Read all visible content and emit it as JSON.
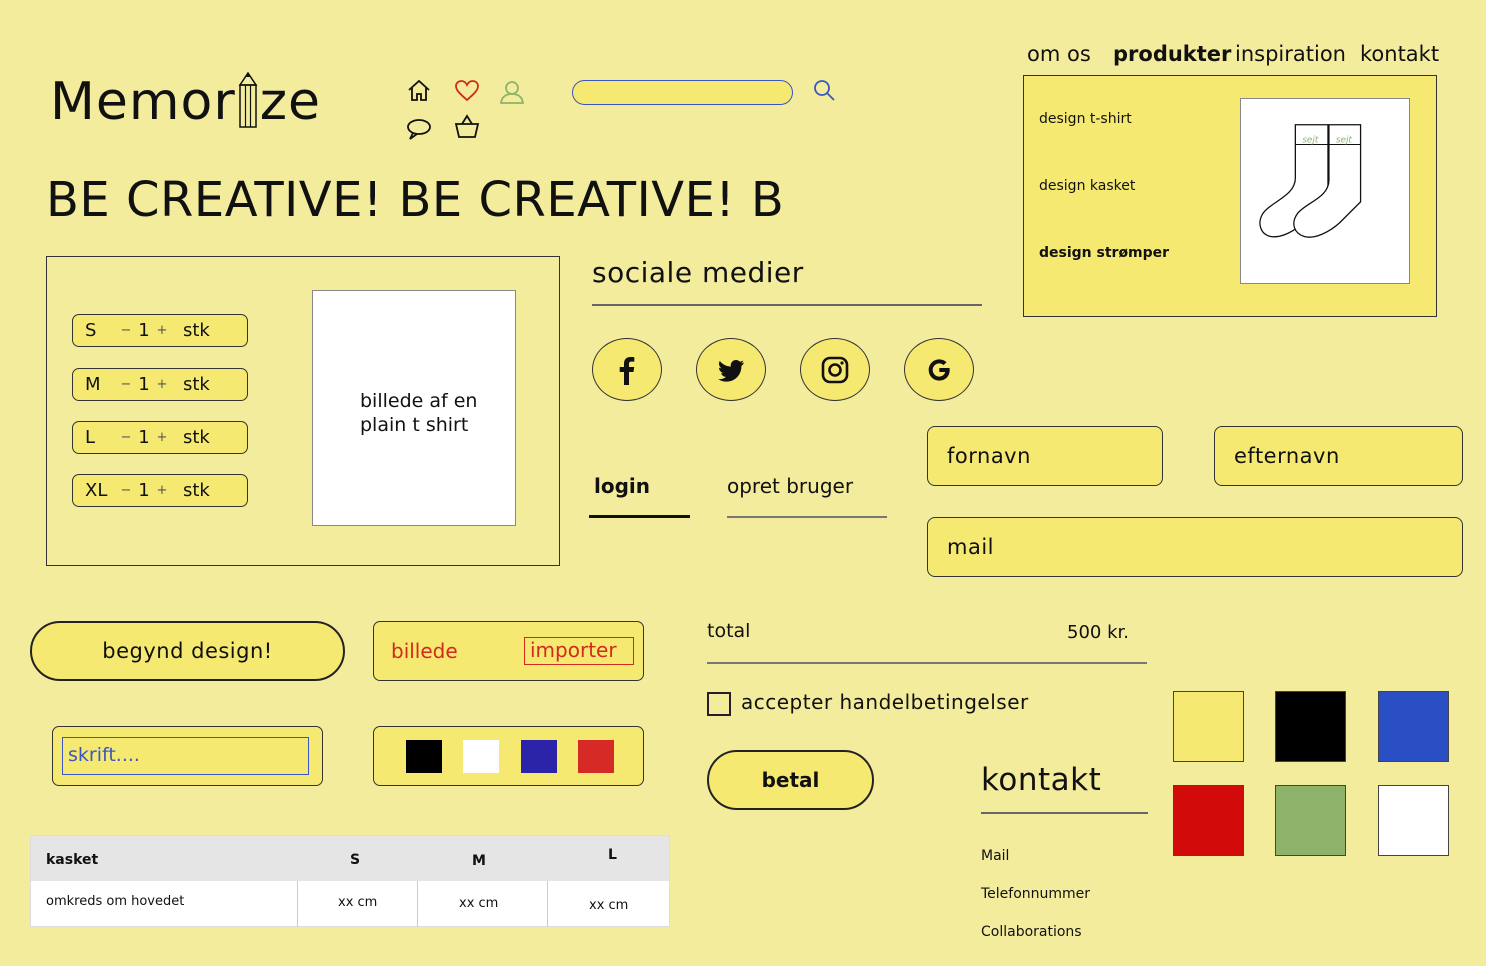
{
  "header": {
    "logo_text_before": "Memor",
    "logo_text_after": "ze",
    "search_placeholder": "",
    "nav": [
      "om os",
      "produkter",
      "inspiration",
      "kontakt"
    ],
    "nav_active": "produkter"
  },
  "icons": [
    "home-icon",
    "heart-icon",
    "user-icon",
    "search-icon",
    "chat-icon",
    "basket-icon"
  ],
  "headline": "BE CREATIVE! BE CREATIVE! B",
  "products_menu": {
    "items": [
      "design t-shirt",
      "design kasket",
      "design strømper"
    ],
    "active": "design strømper",
    "sock_label_left": "sejt",
    "sock_label_right": "sejt"
  },
  "size_selector": {
    "rows": [
      {
        "size": "S",
        "qty": "1",
        "unit": "stk"
      },
      {
        "size": "M",
        "qty": "1",
        "unit": "stk"
      },
      {
        "size": "L",
        "qty": "1",
        "unit": "stk"
      },
      {
        "size": "XL",
        "qty": "1",
        "unit": "stk"
      }
    ],
    "minus": "−",
    "plus": "+",
    "image_text": "billede af en plain t shirt"
  },
  "social": {
    "title": "sociale medier",
    "buttons": [
      "facebook-icon",
      "twitter-icon",
      "instagram-icon",
      "google-icon"
    ]
  },
  "auth": {
    "tabs": [
      "login",
      "opret bruger"
    ],
    "active_tab": "login",
    "fields": {
      "firstname": "fornavn",
      "lastname": "efternavn",
      "mail": "mail"
    }
  },
  "design_tools": {
    "start_button": "begynd design!",
    "image_label": "billede",
    "import_button": "importer",
    "text_placeholder": "skrift....",
    "mini_colors": [
      "#000000",
      "#ffffff",
      "#2b24a8",
      "#d62a26"
    ]
  },
  "size_table": {
    "headers": [
      "kasket",
      "S",
      "M",
      "L"
    ],
    "row": [
      "omkreds om hovedet",
      "xx cm",
      "xx cm",
      "xx cm"
    ]
  },
  "checkout": {
    "total_label": "total",
    "total_value": "500 kr.",
    "terms_label": "accepter handelbetingelser",
    "terms_checked": false,
    "pay_button": "betal"
  },
  "contact": {
    "title": "kontakt",
    "items": [
      "Mail",
      "Telefonnummer",
      "Collaborations"
    ]
  },
  "color_swatches": [
    "#f5e972",
    "#000000",
    "#2a4fc4",
    "#d30a0a",
    "#8db36a",
    "#ffffff"
  ],
  "accent_colors": {
    "background": "#f3ec9c",
    "yellow": "#f5e972",
    "blue": "#3b56c4",
    "red": "#d22a1c",
    "green": "#8db36a"
  }
}
